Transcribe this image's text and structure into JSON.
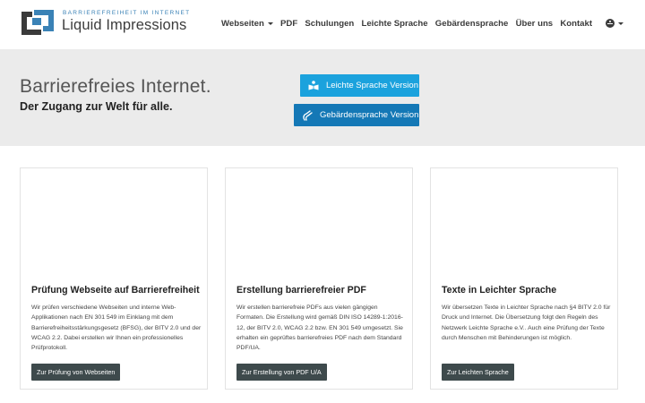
{
  "header": {
    "logo": {
      "tagline": "BARRIEREFREIHEIT IM INTERNET",
      "name": "Liquid Impressions"
    },
    "nav": [
      {
        "label": "Webseiten",
        "dropdown": true
      },
      {
        "label": "PDF"
      },
      {
        "label": "Schulungen"
      },
      {
        "label": "Leichte Sprache"
      },
      {
        "label": "Gebärdensprache"
      },
      {
        "label": "Über uns"
      },
      {
        "label": "Kontakt"
      }
    ],
    "accessibility_icon": "accessibility-icon"
  },
  "hero": {
    "title": "Barrierefreies Internet.",
    "subtitle": "Der Zugang zur Welt für alle.",
    "buttons": {
      "easy_language": "Leichte Sprache Version",
      "sign_language": "Gebärdensprache Version"
    }
  },
  "cards": [
    {
      "title": "Prüfung Webseite auf Barrierefreiheit",
      "text": "Wir prüfen verschiedene Webseiten und interne Web-Applikationen nach EN 301 549 im Einklang mit dem Barrierefreiheitsstärkungsgesetz (BFSG), der BITV 2.0 und der WCAG 2.2. Dabei erstellen wir Ihnen ein professionelles Prüfprotokoll.",
      "button": "Zur Prüfung von Webseiten"
    },
    {
      "title": "Erstellung barrierefreier PDF",
      "text": "Wir erstellen barrierefreie PDFs aus vielen gängigen Formaten. Die Erstellung wird gemäß DIN ISO 14289-1:2016-12, der BITV 2.0, WCAG 2.2 bzw. EN 301 549 umgesetzt. Sie erhalten ein geprüftes barrierefreies PDF nach dem Standard PDF/UA.",
      "button": "Zur Erstellung von PDF U/A"
    },
    {
      "title": "Texte in Leichter Sprache",
      "text": "Wir übersetzen Texte in Leichter Sprache nach §4 BITV 2.0 für Druck und Internet. Die Übersetzung folgt den Regeln des Netzwerk Leichte Sprache e.V.. Auch eine Prüfung der Texte durch Menschen mit Behinderungen ist möglich.",
      "button": "Zur Leichten Sprache"
    }
  ],
  "colors": {
    "accent_light": "#1ba2dd",
    "accent_dark": "#1478b6",
    "card_button": "#3e4a4c",
    "hero_background": "#ebebeb"
  }
}
